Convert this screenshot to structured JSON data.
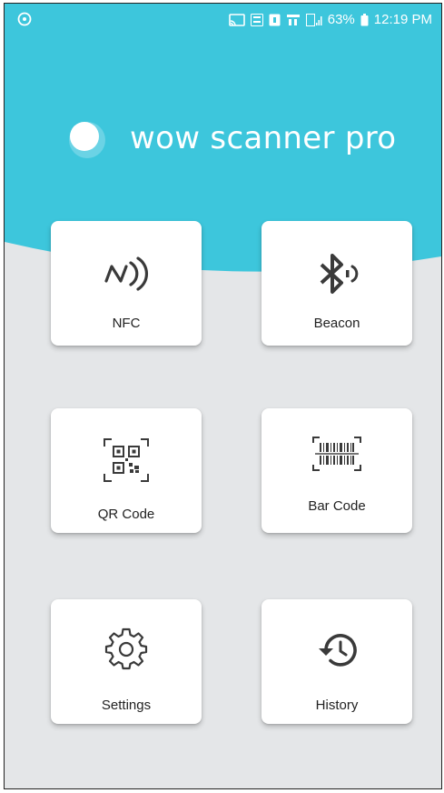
{
  "status_bar": {
    "battery": "63%",
    "time": "12:19 PM",
    "icons": [
      "android-icon",
      "cast-icon",
      "volte-icon",
      "sim-icon",
      "lte-icon",
      "signal-icon",
      "battery-icon"
    ]
  },
  "app": {
    "name": "wow scanner pro",
    "logo_icon": "circle-logo-icon"
  },
  "colors": {
    "header": "#3dc6dc",
    "background": "#e4e6e8",
    "card": "#ffffff",
    "icon": "#3a3a3a"
  },
  "menu": [
    {
      "label": "NFC",
      "icon": "nfc-icon"
    },
    {
      "label": "Beacon",
      "icon": "bluetooth-beacon-icon"
    },
    {
      "label": "QR Code",
      "icon": "qr-code-icon"
    },
    {
      "label": "Bar Code",
      "icon": "barcode-icon"
    },
    {
      "label": "Settings",
      "icon": "gear-icon"
    },
    {
      "label": "History",
      "icon": "history-icon"
    }
  ]
}
